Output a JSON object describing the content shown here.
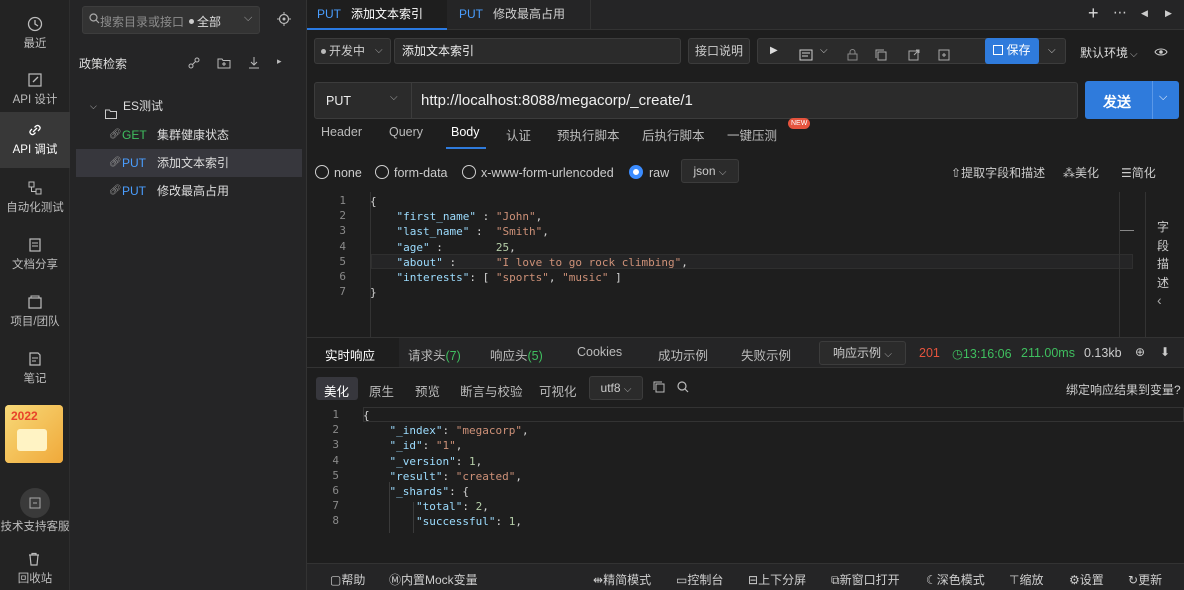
{
  "rail": [
    {
      "label": "最近",
      "icon": "clock-icon"
    },
    {
      "label": "API 设计",
      "icon": "edit-icon"
    },
    {
      "label": "API 调试",
      "icon": "link-icon"
    },
    {
      "label": "自动化测试",
      "icon": "flow-icon"
    },
    {
      "label": "文档分享",
      "icon": "doc-icon"
    },
    {
      "label": "项目/团队",
      "icon": "folder-icon"
    },
    {
      "label": "笔记",
      "icon": "note-icon"
    },
    {
      "label": "技术支持客服",
      "icon": "support-icon"
    },
    {
      "label": "回收站",
      "icon": "trash-icon"
    }
  ],
  "promo": {
    "year": "2022"
  },
  "tree": {
    "search_placeholder": "搜索目录或接口",
    "filter": "全部",
    "section_title": "政策检索",
    "folder": "ES测试",
    "items": [
      {
        "method": "GET",
        "name": "集群健康状态"
      },
      {
        "method": "PUT",
        "name": "添加文本索引"
      },
      {
        "method": "PUT",
        "name": "修改最高占用"
      }
    ]
  },
  "tabs": [
    {
      "method": "PUT",
      "name": "添加文本索引"
    },
    {
      "method": "PUT",
      "name": "修改最高占用"
    }
  ],
  "toolbar": {
    "status": "开发中",
    "api_name": "添加文本索引",
    "doc_btn": "接口说明",
    "save": "保存",
    "env": "默认环境"
  },
  "request": {
    "method": "PUT",
    "url": "http://localhost:8088/megacorp/_create/1",
    "send": "发送"
  },
  "req_tabs": [
    "Header",
    "Query",
    "Body",
    "认证",
    "预执行脚本",
    "后执行脚本",
    "一键压测"
  ],
  "new_badge": "NEW",
  "body_types": [
    "none",
    "form-data",
    "x-www-form-urlencoded",
    "raw"
  ],
  "body_format": "json",
  "body_actions": {
    "extract": "提取字段和描述",
    "beautify": "美化",
    "simplify": "简化"
  },
  "side_label": [
    "字",
    "段",
    "描",
    "述"
  ],
  "req_code": [
    "{",
    "    \"first_name\" : \"John\",",
    "    \"last_name\" :  \"Smith\",",
    "    \"age\" :        25,",
    "    \"about\" :      \"I love to go rock climbing\",",
    "    \"interests\": [ \"sports\", \"music\" ]",
    "}"
  ],
  "resp_tabs": [
    "实时响应",
    "请求头",
    "响应头",
    "Cookies",
    "成功示例",
    "失败示例"
  ],
  "resp_counts": {
    "req_headers": "(7)",
    "resp_headers": "(5)"
  },
  "resp_example": "响应示例",
  "resp_meta": {
    "status": "201",
    "time": "13:16:06",
    "duration": "211.00ms",
    "size": "0.13kb"
  },
  "resp_view_tabs": [
    "美化",
    "原生",
    "预览",
    "断言与校验",
    "可视化"
  ],
  "resp_encoding": "utf8",
  "bind_var": "绑定响应结果到变量?",
  "resp_code": [
    "{",
    "    \"_index\": \"megacorp\",",
    "    \"_id\": \"1\",",
    "    \"_version\": 1,",
    "    \"result\": \"created\",",
    "    \"_shards\": {",
    "        \"total\": 2,",
    "        \"successful\": 1,"
  ],
  "footer": [
    "帮助",
    "内置Mock变量",
    "精简模式",
    "控制台",
    "上下分屏",
    "新窗口打开",
    "深色模式",
    "缩放",
    "设置",
    "更新"
  ]
}
